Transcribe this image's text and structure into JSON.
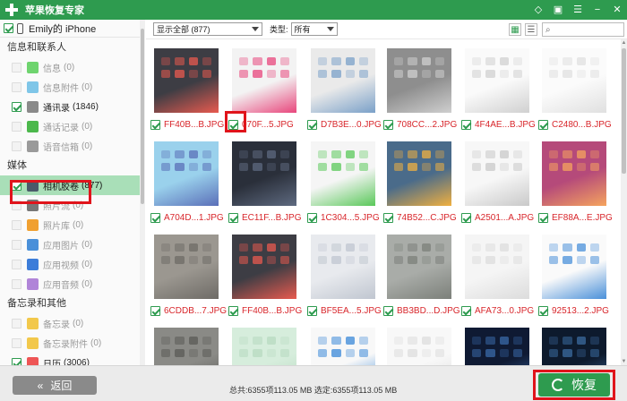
{
  "app": {
    "title": "苹果恢复专家"
  },
  "device": {
    "name": "Emily的 iPhone"
  },
  "sidebar": {
    "groups": [
      {
        "header": "信息和联系人",
        "items": [
          {
            "label": "信息",
            "count": "(0)",
            "icon": "message-icon",
            "color": "#6fd46f",
            "checked": false,
            "enabled": false
          },
          {
            "label": "信息附件",
            "count": "(0)",
            "icon": "attachment-icon",
            "color": "#7fc6e8",
            "checked": false,
            "enabled": false
          },
          {
            "label": "通讯录",
            "count": "(1846)",
            "icon": "contacts-icon",
            "color": "#8a8a8a",
            "checked": true,
            "enabled": true
          },
          {
            "label": "通话记录",
            "count": "(0)",
            "icon": "phone-icon",
            "color": "#4cb84c",
            "checked": false,
            "enabled": false
          },
          {
            "label": "语音信箱",
            "count": "(0)",
            "icon": "voicemail-icon",
            "color": "#9a9a9a",
            "checked": false,
            "enabled": false
          }
        ]
      },
      {
        "header": "媒体",
        "items": [
          {
            "label": "相机胶卷",
            "count": "(877)",
            "icon": "camera-icon",
            "color": "#4a5a6a",
            "checked": true,
            "enabled": true,
            "active": true
          },
          {
            "label": "照片流",
            "count": "(0)",
            "icon": "photostream-icon",
            "color": "#777777",
            "checked": false,
            "enabled": false
          },
          {
            "label": "照片库",
            "count": "(0)",
            "icon": "photos-icon",
            "color": "#f0a030",
            "checked": false,
            "enabled": false
          },
          {
            "label": "应用图片",
            "count": "(0)",
            "icon": "app-photos-icon",
            "color": "#4a90d9",
            "checked": false,
            "enabled": false
          },
          {
            "label": "应用视频",
            "count": "(0)",
            "icon": "app-videos-icon",
            "color": "#3c7dd9",
            "checked": false,
            "enabled": false
          },
          {
            "label": "应用音频",
            "count": "(0)",
            "icon": "app-audio-icon",
            "color": "#b084d8",
            "checked": false,
            "enabled": false
          }
        ]
      },
      {
        "header": "备忘录和其他",
        "items": [
          {
            "label": "备忘录",
            "count": "(0)",
            "icon": "notes-icon",
            "color": "#f2c84b",
            "checked": false,
            "enabled": false
          },
          {
            "label": "备忘录附件",
            "count": "(0)",
            "icon": "notes-attachment-icon",
            "color": "#f2c84b",
            "checked": false,
            "enabled": false
          },
          {
            "label": "日历",
            "count": "(3006)",
            "icon": "calendar-icon",
            "color": "#e55",
            "checked": true,
            "enabled": true
          }
        ]
      }
    ]
  },
  "toolbar": {
    "filter_value": "显示全部 (877)",
    "type_label": "类型:",
    "type_value": "所有",
    "search_placeholder": ""
  },
  "grid": {
    "rows": [
      [
        {
          "name": "FF40B...B.JPG",
          "checked": true,
          "bg": "#3d3d44",
          "accent": "#e85a4f"
        },
        {
          "name": "070F...5.JPG",
          "checked": true,
          "bg": "#f3f3f3",
          "accent": "#e8467c"
        },
        {
          "name": "D7B3E...0.JPG",
          "checked": true,
          "bg": "#eaeaea",
          "accent": "#7aa0c8"
        },
        {
          "name": "708CC...2.JPG",
          "checked": true,
          "bg": "#8e8e8e",
          "accent": "#cfcfcf"
        },
        {
          "name": "4F4AE...B.JPG",
          "checked": true,
          "bg": "#fafafa",
          "accent": "#d0d0d0"
        },
        {
          "name": "C2480...B.JPG",
          "checked": true,
          "bg": "#fbfbfb",
          "accent": "#e0e0e0"
        }
      ],
      [
        {
          "name": "A704D...1.JPG",
          "checked": true,
          "bg": "#9ad1ec",
          "accent": "#5a6fb8"
        },
        {
          "name": "EC11F...B.JPG",
          "checked": true,
          "bg": "#2a2f3a",
          "accent": "#5e6a80"
        },
        {
          "name": "1C304...5.JPG",
          "checked": true,
          "bg": "#f5f5f5",
          "accent": "#5ac85a"
        },
        {
          "name": "74B52...C.JPG",
          "checked": true,
          "bg": "#4a6b8a",
          "accent": "#f0b040"
        },
        {
          "name": "A2501...A.JPG",
          "checked": true,
          "bg": "#f7f7f7",
          "accent": "#c9c9c9"
        },
        {
          "name": "EF88A...E.JPG",
          "checked": true,
          "bg": "#b54a7a",
          "accent": "#f5a45e"
        }
      ],
      [
        {
          "name": "6CDDB...7.JPG",
          "checked": true,
          "bg": "#9b9790",
          "accent": "#6e6b66"
        },
        {
          "name": "FF40B...B.JPG",
          "checked": true,
          "bg": "#3d3d44",
          "accent": "#e85a4f"
        },
        {
          "name": "BF5EA...5.JPG",
          "checked": true,
          "bg": "#e8eaee",
          "accent": "#c0c6d0"
        },
        {
          "name": "BB3BD...D.JPG",
          "checked": true,
          "bg": "#a9aca8",
          "accent": "#7c807a"
        },
        {
          "name": "AFA73...0.JPG",
          "checked": true,
          "bg": "#f5f5f5",
          "accent": "#dcdcdc"
        },
        {
          "name": "92513...2.JPG",
          "checked": true,
          "bg": "#fafafa",
          "accent": "#4a90d9"
        }
      ],
      [
        {
          "name": "",
          "checked": false,
          "bg": "#8a8a86",
          "accent": "#5a5a56"
        },
        {
          "name": "",
          "checked": false,
          "bg": "#d6eddc",
          "accent": "#b7d9c0"
        },
        {
          "name": "",
          "checked": false,
          "bg": "#f8f8f8",
          "accent": "#3a88d8"
        },
        {
          "name": "",
          "checked": false,
          "bg": "#f8f8f8",
          "accent": "#dddddd"
        },
        {
          "name": "",
          "checked": false,
          "bg": "#0f1a33",
          "accent": "#3a6aa8"
        },
        {
          "name": "",
          "checked": false,
          "bg": "#0d1a2d",
          "accent": "#3b6b9f"
        }
      ]
    ]
  },
  "bottom": {
    "back_label": "返回",
    "status": "总共:6355项113.05 MB 选定:6355项113.05 MB",
    "recover_label": "恢复"
  }
}
